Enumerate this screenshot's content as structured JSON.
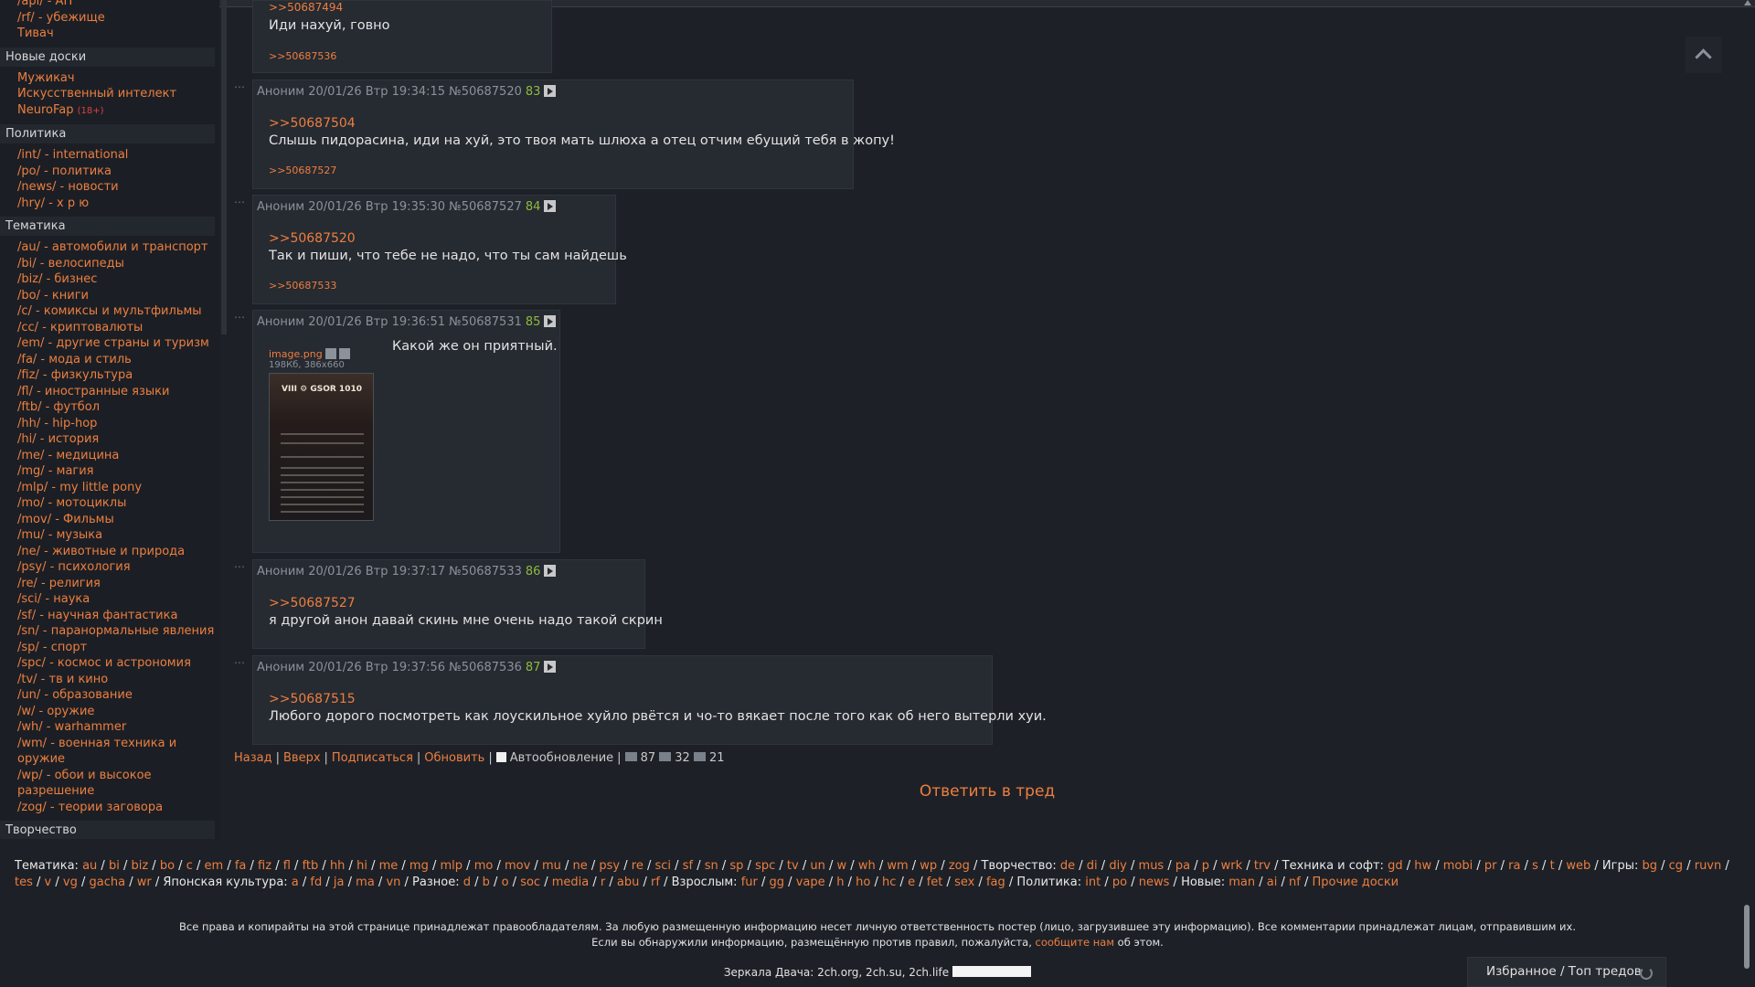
{
  "sidebar": {
    "top_items": [
      "/api/ - АП",
      "/rf/ - убежище",
      "Тивач"
    ],
    "sections": [
      {
        "title": "Новые доски",
        "items": [
          "Мужикач",
          "Искусственный интелект",
          "NeuroFap"
        ],
        "badge": "(18+)"
      },
      {
        "title": "Политика",
        "items": [
          "/int/ - international",
          "/po/ - политика",
          "/news/ - новости",
          "/hry/ - х р ю"
        ]
      },
      {
        "title": "Тематика",
        "items": [
          "/au/ - автомобили и транспорт",
          "/bi/ - велосипеды",
          "/biz/ - бизнес",
          "/bo/ - книги",
          "/c/ - комиксы и мультфильмы",
          "/cc/ - криптовалюты",
          "/em/ - другие страны и туризм",
          "/fa/ - мода и стиль",
          "/fiz/ - физкультура",
          "/fl/ - иностранные языки",
          "/ftb/ - футбол",
          "/hh/ - hip-hop",
          "/hi/ - история",
          "/me/ - медицина",
          "/mg/ - магия",
          "/mlp/ - my little pony",
          "/mo/ - мотоциклы",
          "/mov/ - Фильмы",
          "/mu/ - музыка",
          "/ne/ - животные и природа",
          "/psy/ - психология",
          "/re/ - религия",
          "/sci/ - наука",
          "/sf/ - научная фантастика",
          "/sn/ - паранормальные явления",
          "/sp/ - спорт",
          "/spc/ - космос и астрономия",
          "/tv/ - тв и кино",
          "/un/ - образование",
          "/w/ - оружие",
          "/wh/ - warhammer",
          "/wm/ - военная техника и оружие",
          "/wp/ - обои и высокое разрешение",
          "/zog/ - теории заговора"
        ]
      },
      {
        "title": "Творчество",
        "items": []
      }
    ]
  },
  "posts": [
    {
      "id": "p0",
      "text": "Иди нахуй, говно",
      "back": ">>50687536",
      "partial_header": ">>50687494"
    },
    {
      "id": "p1",
      "author": "Аноним",
      "date": "20/01/26 Втр 19:34:15",
      "no": "№50687520",
      "count": "83",
      "reply": ">>50687504",
      "text": "Слышь пидорасина, иди на хуй, это твоя мать шлюха а отец отчим ебущий тебя в жопу!",
      "back": ">>50687527"
    },
    {
      "id": "p2",
      "author": "Аноним",
      "date": "20/01/26 Втр 19:35:30",
      "no": "№50687527",
      "count": "84",
      "reply": ">>50687520",
      "text": "Так и пиши, что тебе не надо, что ты сам найдешь",
      "back": ">>50687533"
    },
    {
      "id": "p3",
      "author": "Аноним",
      "date": "20/01/26 Втр 19:36:51",
      "no": "№50687531",
      "count": "85",
      "file_name": "image.png",
      "file_meta": "198Кб, 386x660",
      "thumb_title": "VIII ⚙ GSOR 1010",
      "text": "Какой же он приятный."
    },
    {
      "id": "p4",
      "author": "Аноним",
      "date": "20/01/26 Втр 19:37:17",
      "no": "№50687533",
      "count": "86",
      "reply": ">>50687527",
      "text": "я другой анон давай скинь мне очень надо такой скрин"
    },
    {
      "id": "p5",
      "author": "Аноним",
      "date": "20/01/26 Втр 19:37:56",
      "no": "№50687536",
      "count": "87",
      "reply": ">>50687515",
      "text": "Любого дорого посмотреть как лоускильное хуйло рвётся и чо-то вякает после того как об него вытерли хуи."
    }
  ],
  "navbar": {
    "back": "Назад",
    "up": "Вверх",
    "subscribe": "Подписаться",
    "refresh": "Обновить",
    "autorefresh": "Автообновление",
    "posts_count": "87",
    "files_count": "32",
    "posters_count": "21"
  },
  "reply_thread": "Ответить в тред",
  "boards_line": {
    "groups": [
      {
        "label": "Тематика:",
        "boards": [
          "au",
          "bi",
          "biz",
          "bo",
          "c",
          "em",
          "fa",
          "fiz",
          "fl",
          "ftb",
          "hh",
          "hi",
          "me",
          "mg",
          "mlp",
          "mo",
          "mov",
          "mu",
          "ne",
          "psy",
          "re",
          "sci",
          "sf",
          "sn",
          "sp",
          "spc",
          "tv",
          "un",
          "w",
          "wh",
          "wm",
          "wp",
          "zog"
        ]
      },
      {
        "label": "Творчество:",
        "boards": [
          "de",
          "di",
          "diy",
          "mus",
          "pa",
          "p",
          "wrk",
          "trv"
        ]
      },
      {
        "label": "Техника и софт:",
        "boards": [
          "gd",
          "hw",
          "mobi",
          "pr",
          "ra",
          "s",
          "t",
          "web"
        ]
      },
      {
        "label": "Игры:",
        "boards": [
          "bg",
          "cg",
          "ruvn",
          "tes",
          "v",
          "vg",
          "gacha",
          "wr"
        ]
      },
      {
        "label": "Японская культура:",
        "boards": [
          "a",
          "fd",
          "ja",
          "ma",
          "vn"
        ]
      },
      {
        "label": "Разное:",
        "boards": [
          "d",
          "b",
          "o",
          "soc",
          "media",
          "r",
          "abu",
          "rf"
        ]
      },
      {
        "label": "Взрослым:",
        "boards": [
          "fur",
          "gg",
          "vape",
          "h",
          "ho",
          "hc",
          "e",
          "fet",
          "sex",
          "fag"
        ]
      },
      {
        "label": "Политика:",
        "boards": [
          "int",
          "po",
          "news"
        ]
      },
      {
        "label": "Новые:",
        "boards": [
          "man",
          "ai",
          "nf"
        ]
      }
    ],
    "other": "Прочие доски"
  },
  "footer": {
    "line1": "Все права и копирайты на этой странице принадлежат правообладателям. За любую размещенную информацию несет личную ответственность постер (лицо, загрузившее эту информацию). Все комментарии принадлежат лицам, отправившим их.",
    "line2_pre": "Если вы обнаружили информацию, размещённую против правил, пожалуйста,",
    "line2_link": "сообщите нам",
    "line2_post": "об этом.",
    "mirrors": "Зеркала Двача: 2ch.org, 2ch.su, 2ch.life"
  },
  "favorites": "Избранное / Топ тредов"
}
